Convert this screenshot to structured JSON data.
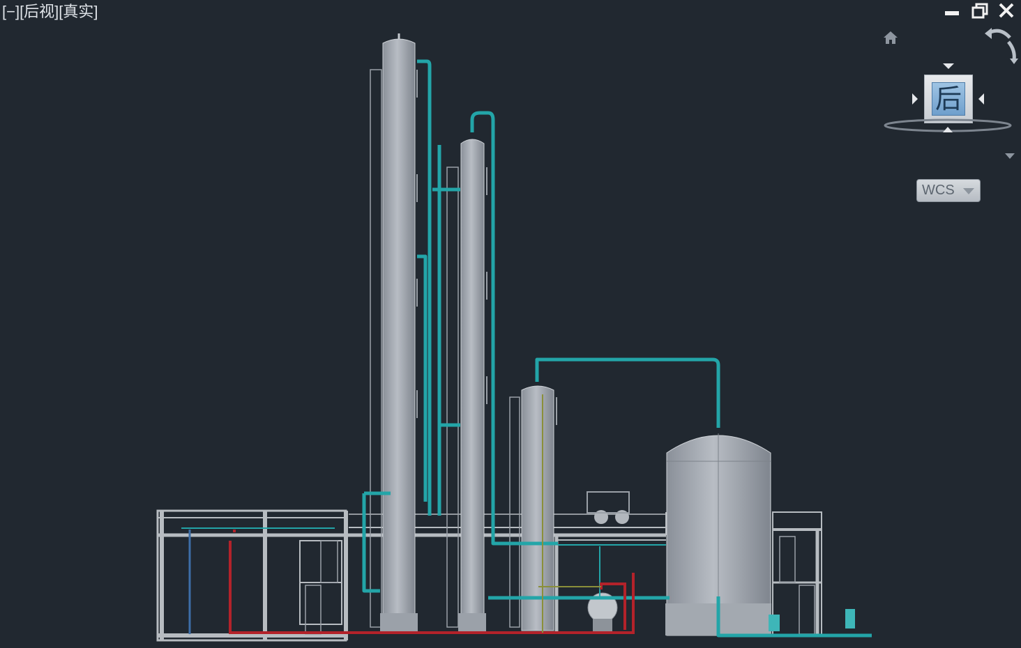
{
  "viewport": {
    "label": "[−][后视][真实]",
    "background": "#212830"
  },
  "window_controls": {
    "icons": [
      "minimize-icon",
      "restore-icon",
      "close-icon"
    ]
  },
  "viewcube": {
    "face_label": "后",
    "icons": [
      "home-icon",
      "rotate-icon",
      "arrow-up-icon",
      "arrow-left-icon",
      "arrow-right-icon",
      "compass-ring-icon",
      "viewcube-menu-icon"
    ]
  },
  "ucs_menu": {
    "label": "WCS"
  },
  "scene": {
    "description_colors": {
      "vessel_fill": "#a9aeb5",
      "pipe_teal": "#23a5a8",
      "pipe_red": "#b3222a",
      "structure_gray": "#b7bcc1"
    }
  }
}
